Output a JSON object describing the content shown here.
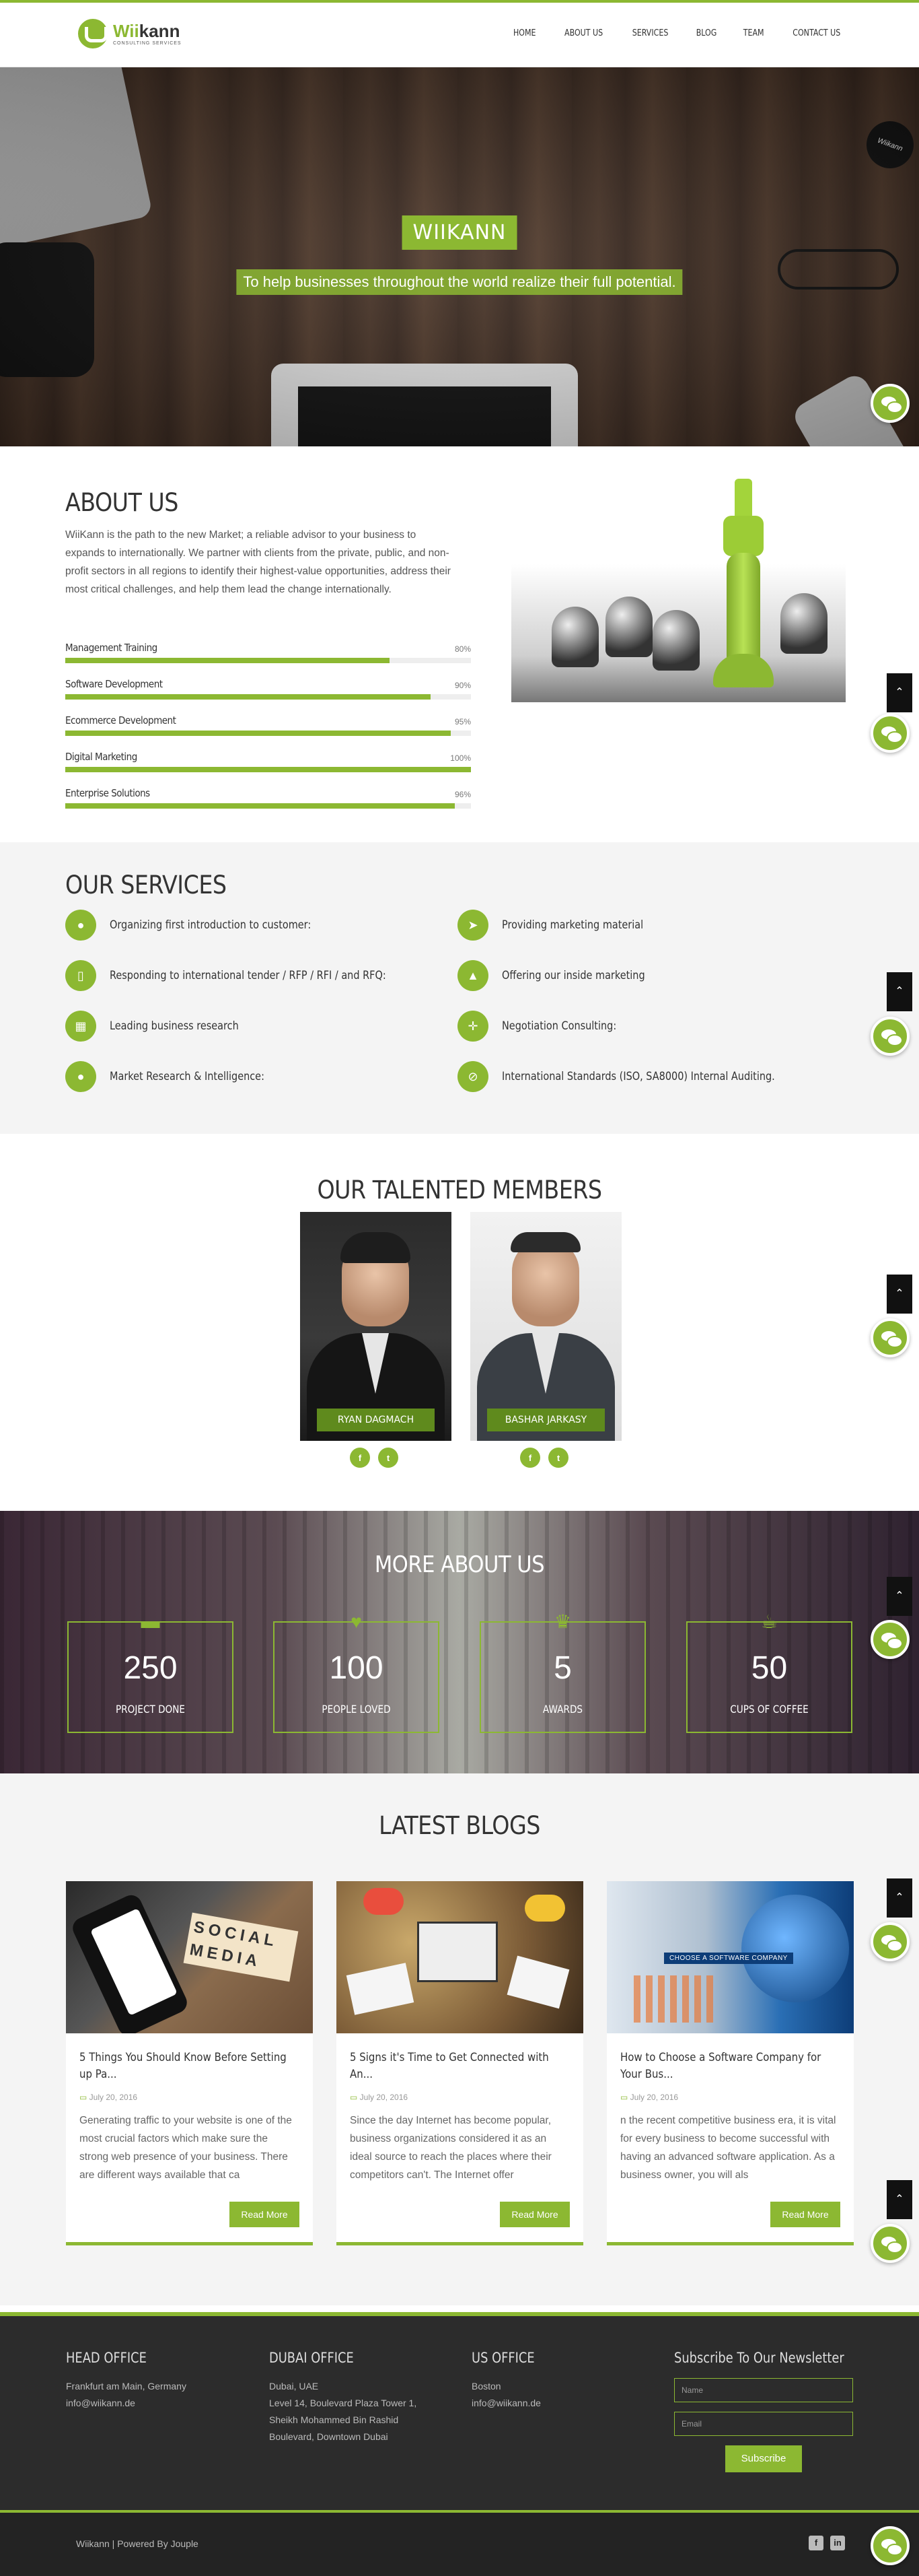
{
  "brand": {
    "name_a": "Wii",
    "name_b": "kann",
    "tagline": "CONSULTING SERVICES"
  },
  "nav": [
    "HOME",
    "ABOUT US",
    "SERVICES",
    "BLOG",
    "TEAM",
    "CONTACT US"
  ],
  "hero": {
    "title": "WIIKANN",
    "subtitle": "To help businesses throughout the world realize their full potential.",
    "puck_text": "Wiikann"
  },
  "about": {
    "title": "ABOUT US",
    "description": "WiiKann is the path to the new Market; a reliable advisor to your business to expands to internationally. We partner with clients from the private, public, and non-profit sectors in all regions to identify their highest-value opportunities, address their most critical challenges, and help them lead the change internationally.",
    "skills": [
      {
        "name": "Management Training",
        "percent_label": "80%",
        "value": 80
      },
      {
        "name": "Software Development",
        "percent_label": "90%",
        "value": 90
      },
      {
        "name": "Ecommerce Development",
        "percent_label": "95%",
        "value": 95
      },
      {
        "name": "Digital Marketing",
        "percent_label": "100%",
        "value": 100
      },
      {
        "name": "Enterprise Solutions",
        "percent_label": "96%",
        "value": 96
      }
    ]
  },
  "services": {
    "title": "OUR SERVICES",
    "items": [
      {
        "label": "Organizing first introduction to customer:",
        "icon": "handshake-icon",
        "glyph": "●"
      },
      {
        "label": "Providing marketing material",
        "icon": "rocket-icon",
        "glyph": "➤"
      },
      {
        "label": "Responding to international tender / RFP / RFI / and RFQ:",
        "icon": "mobile-icon",
        "glyph": "▯"
      },
      {
        "label": "Offering our inside marketing",
        "icon": "road-icon",
        "glyph": "▲"
      },
      {
        "label": "Leading business research",
        "icon": "grid-icon",
        "glyph": "▦"
      },
      {
        "label": "Negotiation Consulting:",
        "icon": "arrows-icon",
        "glyph": "✛"
      },
      {
        "label": "Market Research & Intelligence:",
        "icon": "user-icon",
        "glyph": "●"
      },
      {
        "label": "International Standards (ISO, SA8000) Internal Auditing.",
        "icon": "compass-icon",
        "glyph": "⊘"
      }
    ]
  },
  "team": {
    "title": "OUR TALENTED MEMBERS",
    "members": [
      {
        "name": "RYAN DAGMACH",
        "social_a": "f",
        "social_b": "t"
      },
      {
        "name": "BASHAR JARKASY",
        "social_a": "f",
        "social_b": "t"
      }
    ]
  },
  "stats": {
    "title": "MORE ABOUT US",
    "items": [
      {
        "number": "250",
        "caption": "PROJECT DONE",
        "icon": "briefcase-icon",
        "glyph": "▬"
      },
      {
        "number": "100",
        "caption": "PEOPLE LOVED",
        "icon": "heart-icon",
        "glyph": "♥"
      },
      {
        "number": "5",
        "caption": "AWARDS",
        "icon": "trophy-icon",
        "glyph": "♛"
      },
      {
        "number": "50",
        "caption": "CUPS OF COFFEE",
        "icon": "coffee-icon",
        "glyph": "☕"
      }
    ]
  },
  "blogs": {
    "title": "LATEST BLOGS",
    "read_more": "Read More",
    "posts": [
      {
        "title": "5 Things You Should Know Before Setting up Pa...",
        "date": "July 20, 2016",
        "excerpt": "Generating traffic to your website is one of the most crucial factors which make sure the strong web presence of your business. There are different ways available that ca",
        "image_text": "SOCIAL MEDIA"
      },
      {
        "title": "5 Signs it's Time to Get Connected with An...",
        "date": "July 20, 2016",
        "excerpt": "Since the day Internet has become popular, business organizations considered it as an ideal source to reach the places where their competitors can't. The Internet offer",
        "image_text": ""
      },
      {
        "title": "How to Choose a Software Company for Your Bus...",
        "date": "July 20, 2016",
        "excerpt": "n the recent competitive business era, it is vital for every business to become successful with having an advanced software application. As a business owner, you will als",
        "image_text": "CHOOSE A SOFTWARE COMPANY"
      }
    ]
  },
  "footer": {
    "head_office": {
      "title": "HEAD OFFICE",
      "lines": [
        "Frankfurt am Main, Germany",
        "info@wiikann.de"
      ]
    },
    "dubai_office": {
      "title": "DUBAI OFFICE",
      "lines": [
        "Dubai, UAE",
        "Level 14, Boulevard Plaza Tower 1,",
        "Sheikh Mohammed Bin Rashid",
        "Boulevard, Downtown Dubai"
      ]
    },
    "us_office": {
      "title": "US OFFICE",
      "lines": [
        "Boston",
        "info@wiikann.de"
      ]
    },
    "newsletter": {
      "title": "Subscribe To Our Newsletter",
      "name_placeholder": "Name",
      "email_placeholder": "Email",
      "button": "Subscribe"
    },
    "credit": "Wiikann | Powered By Jouple",
    "social_a": "f",
    "social_b": "in"
  },
  "colors": {
    "accent": "#8cb832",
    "dark": "#2c2c2c"
  }
}
